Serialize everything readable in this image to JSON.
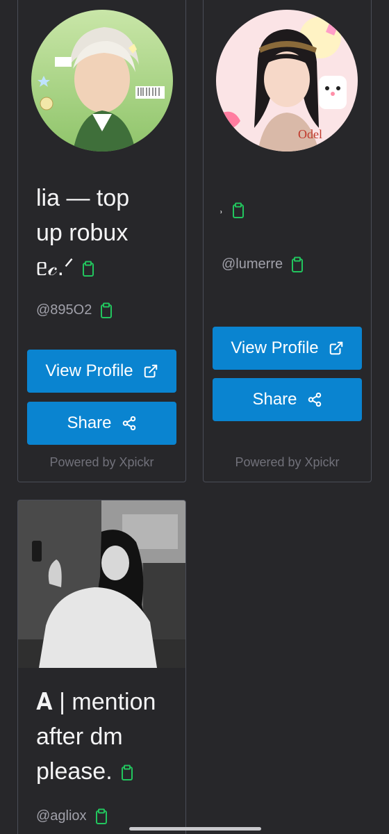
{
  "cards": [
    {
      "name_line1": "lia — top",
      "name_line2": "up robux",
      "name_line3": "ᥱ𝒸.ᐟ",
      "handle": "@895O2",
      "view_label": "View Profile",
      "share_label": "Share",
      "powered": "Powered by Xpickr"
    },
    {
      "name": "˒",
      "handle": "@lumerre",
      "view_label": "View Profile",
      "share_label": "Share",
      "powered": "Powered by Xpickr"
    },
    {
      "name_line1": "𝐀 | mention",
      "name_line2": "after dm",
      "name_line3": "please.",
      "handle": "@agliox"
    }
  ],
  "colors": {
    "background": "#27272a",
    "card_border": "#4a4d57",
    "button": "#0a84d0",
    "clipboard_icon": "#22c55e",
    "muted_text": "#71717a"
  },
  "icons": [
    "clipboard-icon",
    "external-link-icon",
    "share-icon"
  ]
}
